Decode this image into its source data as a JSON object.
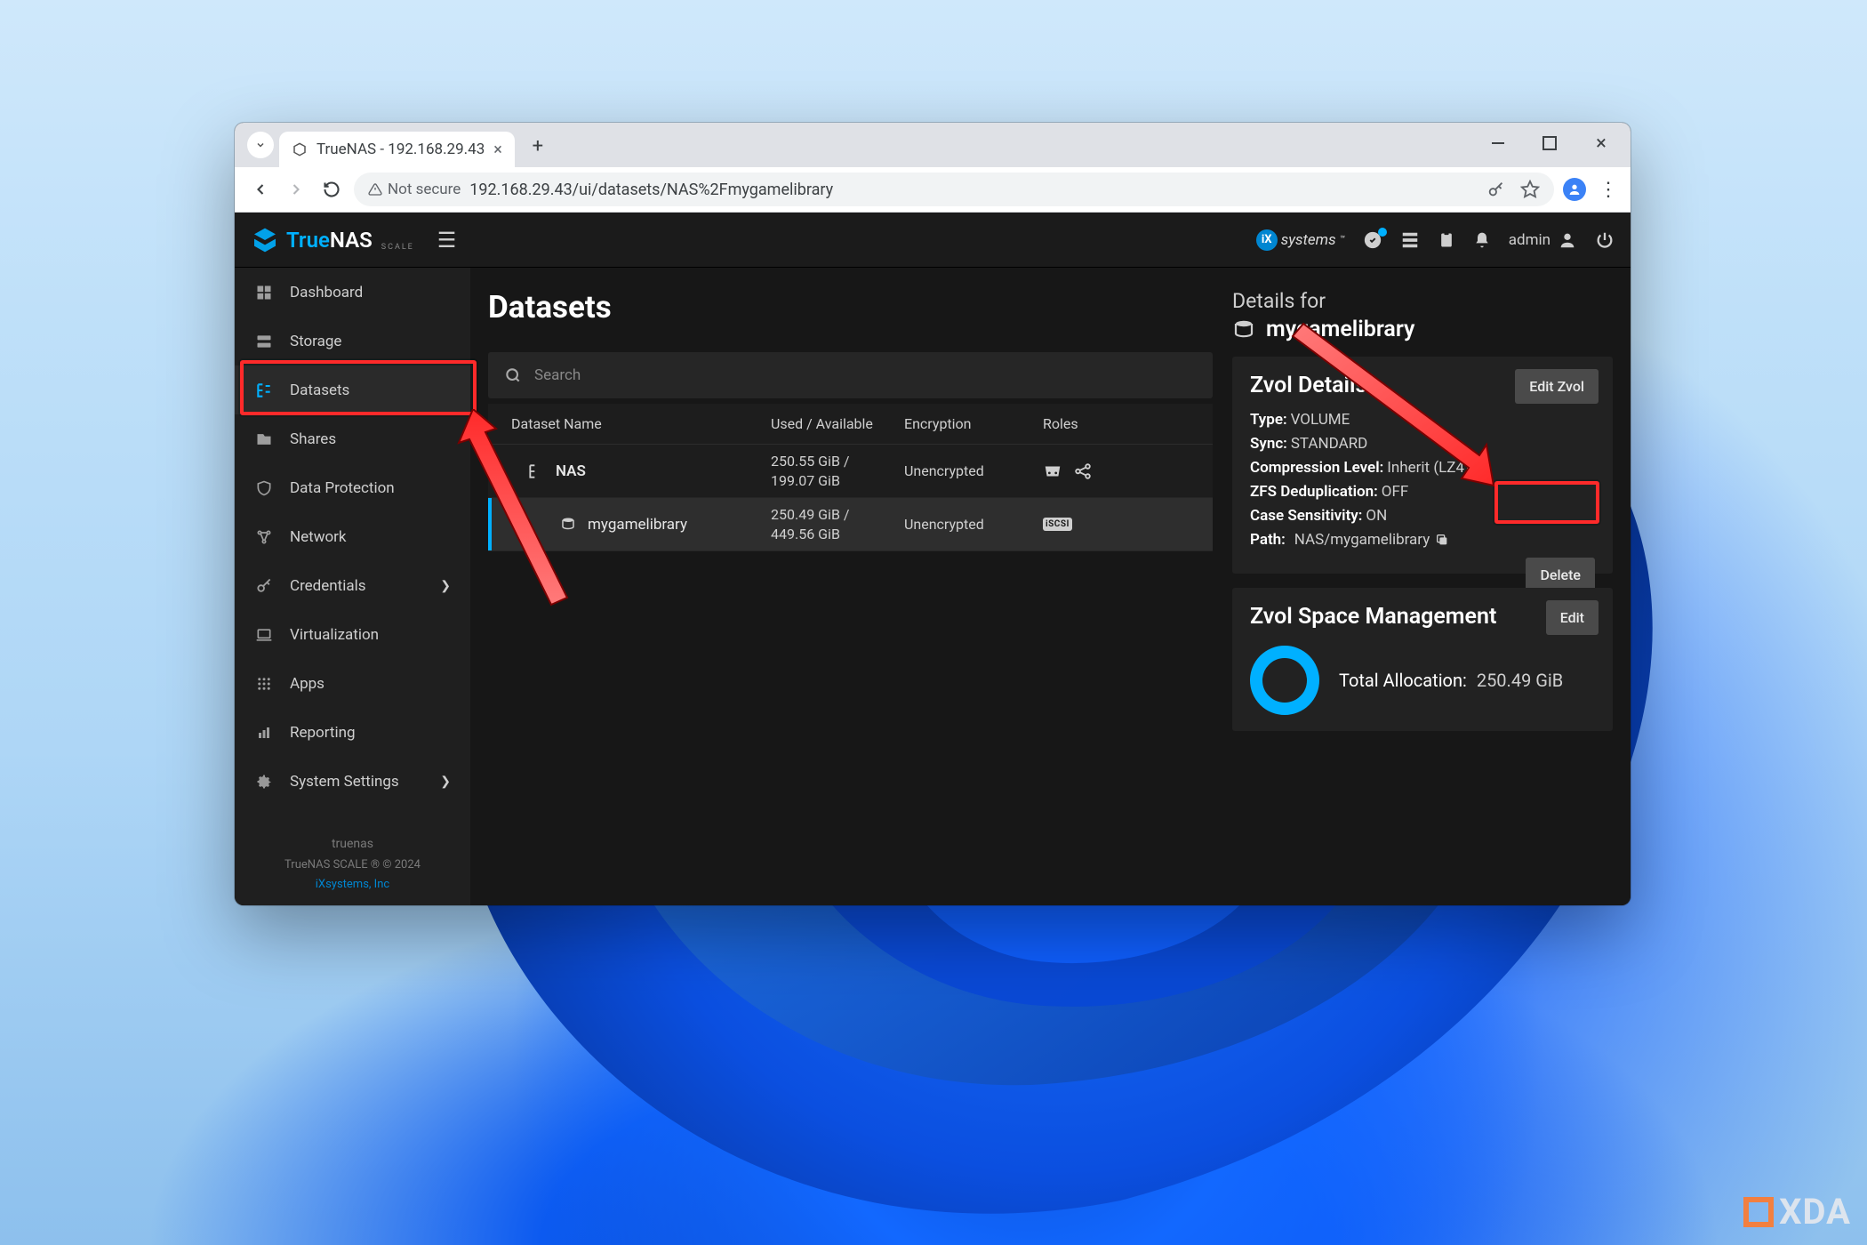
{
  "browser": {
    "tab_title": "TrueNAS - 192.168.29.43",
    "url_display": "192.168.29.43/ui/datasets/NAS%2Fmygamelibrary",
    "not_secure_label": "Not secure"
  },
  "header": {
    "brand_true": "True",
    "brand_nas": "NAS",
    "brand_sub": "SCALE",
    "ix_label": "systems",
    "admin_label": "admin"
  },
  "sidebar": {
    "items": [
      {
        "label": "Dashboard"
      },
      {
        "label": "Storage"
      },
      {
        "label": "Datasets"
      },
      {
        "label": "Shares"
      },
      {
        "label": "Data Protection"
      },
      {
        "label": "Network"
      },
      {
        "label": "Credentials"
      },
      {
        "label": "Virtualization"
      },
      {
        "label": "Apps"
      },
      {
        "label": "Reporting"
      },
      {
        "label": "System Settings"
      }
    ],
    "footer_host": "truenas",
    "footer_copy": "TrueNAS SCALE ® © 2024",
    "footer_link": "iXsystems, Inc"
  },
  "page": {
    "title": "Datasets",
    "search_placeholder": "Search",
    "columns": {
      "name": "Dataset Name",
      "used": "Used / Available",
      "enc": "Encryption",
      "roles": "Roles"
    },
    "rows": [
      {
        "name": "NAS",
        "used_line1": "250.55 GiB /",
        "used_line2": "199.07 GiB",
        "enc": "Unencrypted"
      },
      {
        "name": "mygamelibrary",
        "used_line1": "250.49 GiB /",
        "used_line2": "449.56 GiB",
        "enc": "Unencrypted"
      }
    ]
  },
  "details": {
    "for_label": "Details for",
    "name": "mygamelibrary",
    "zvol_title": "Zvol Details",
    "edit_zvol": "Edit Zvol",
    "kv": {
      "type_k": "Type:",
      "type_v": "VOLUME",
      "sync_k": "Sync:",
      "sync_v": "STANDARD",
      "comp_k": "Compression Level:",
      "comp_v": "Inherit (LZ4)",
      "dedup_k": "ZFS Deduplication:",
      "dedup_v": "OFF",
      "case_k": "Case Sensitivity:",
      "case_v": "ON",
      "path_k": "Path:",
      "path_v": "NAS/mygamelibrary"
    },
    "delete": "Delete",
    "space_title": "Zvol Space Management",
    "space_edit": "Edit",
    "alloc_k": "Total Allocation:",
    "alloc_v": "250.49 GiB"
  },
  "watermark": "XDA"
}
